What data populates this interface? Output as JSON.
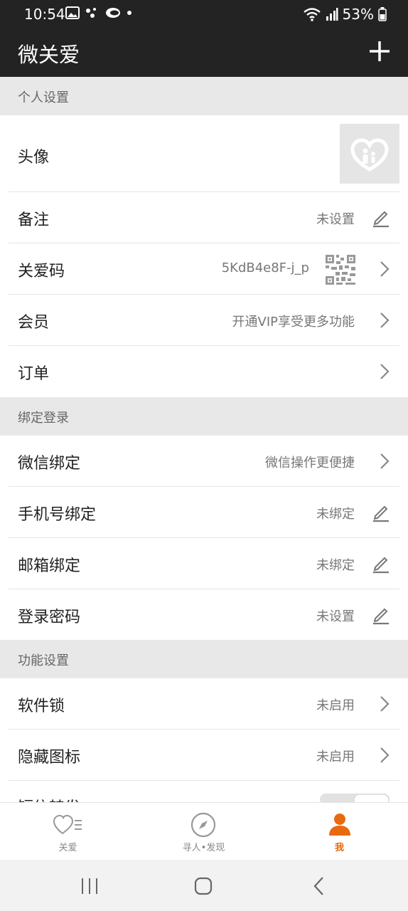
{
  "status_bar": {
    "time": "10:54",
    "battery": "53%"
  },
  "app_bar": {
    "title": "微关爱"
  },
  "sections": {
    "personal": {
      "header": "个人设置",
      "avatar_label": "头像",
      "remark_label": "备注",
      "remark_value": "未设置",
      "care_code_label": "关爱码",
      "care_code_value": "5KdB4e8F-j_p",
      "member_label": "会员",
      "member_value": "开通VIP享受更多功能",
      "order_label": "订单"
    },
    "binding": {
      "header": "绑定登录",
      "wechat_label": "微信绑定",
      "wechat_value": "微信操作更便捷",
      "phone_label": "手机号绑定",
      "phone_value": "未绑定",
      "email_label": "邮箱绑定",
      "email_value": "未绑定",
      "password_label": "登录密码",
      "password_value": "未设置"
    },
    "function": {
      "header": "功能设置",
      "applock_label": "软件锁",
      "applock_value": "未启用",
      "hide_icon_label": "隐藏图标",
      "hide_icon_value": "未启用",
      "partial_label": "短信转发"
    }
  },
  "bottom_nav": {
    "items": [
      {
        "label": "关爱",
        "icon": "heart-list-icon"
      },
      {
        "label": "寻人•发现",
        "icon": "compass-icon"
      },
      {
        "label": "我",
        "icon": "person-icon"
      }
    ],
    "active_index": 2
  },
  "colors": {
    "header_bg": "#232323",
    "accent": "#e86a10",
    "section_bg": "#e8e8e8"
  }
}
